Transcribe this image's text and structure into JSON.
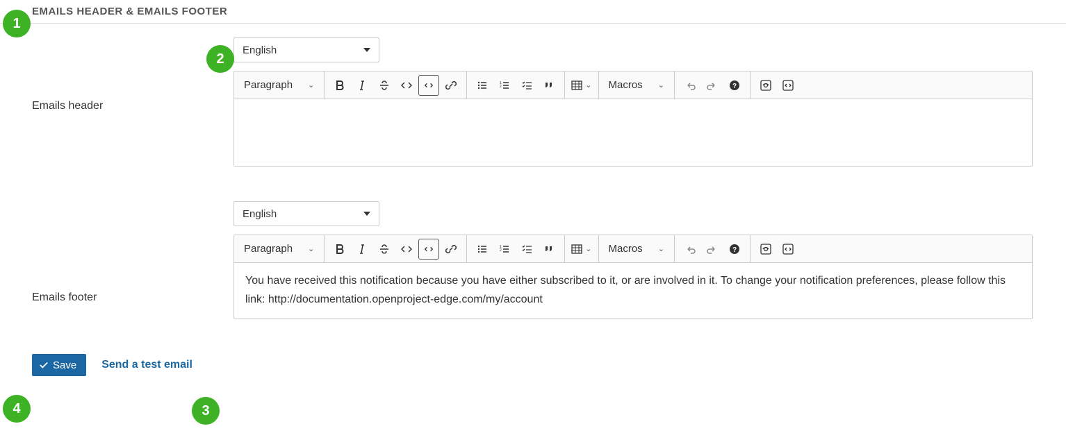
{
  "page": {
    "title": "EMAILS HEADER & EMAILS FOOTER"
  },
  "header_editor": {
    "label": "Emails header",
    "language": "English",
    "paragraph_label": "Paragraph",
    "macros_label": "Macros",
    "content": ""
  },
  "footer_editor": {
    "label": "Emails footer",
    "language": "English",
    "paragraph_label": "Paragraph",
    "macros_label": "Macros",
    "content": "You have received this notification because you have either subscribed to it, or are involved in it. To change your notification preferences, please follow this link: http://documentation.openproject-edge.com/my/account"
  },
  "actions": {
    "save": "Save",
    "test_email": "Send a test email"
  },
  "markers": {
    "m1": "1",
    "m2": "2",
    "m3": "3",
    "m4": "4"
  }
}
